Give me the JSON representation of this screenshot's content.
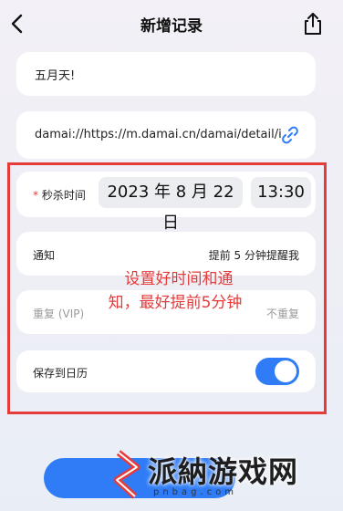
{
  "header": {
    "title": "新增记录",
    "back_icon": "chevron-left-icon",
    "share_icon": "share-icon"
  },
  "name_field": {
    "value": "五月天!"
  },
  "link_field": {
    "value": "damai://https://m.damai.cn/damai/detail/i...",
    "icon": "link-icon"
  },
  "flash_sale": {
    "required_mark": "*",
    "label": "秒杀时间",
    "date": "2023 年 8 月 22 日",
    "time": "13:30"
  },
  "notify": {
    "label": "通知",
    "value": "提前 5 分钟提醒我"
  },
  "repeat": {
    "label": "重复 (VIP)",
    "value": "不重复"
  },
  "calendar": {
    "label": "保存到日历",
    "enabled": true
  },
  "overlay_note": {
    "line1": "设置好时间和通",
    "line2": "知，最好提前5分钟"
  },
  "watermark": {
    "text": "派納游戏网",
    "sub": "pnbag.com"
  },
  "colors": {
    "accent": "#2f7cf6",
    "annotation": "#e53b3b"
  }
}
